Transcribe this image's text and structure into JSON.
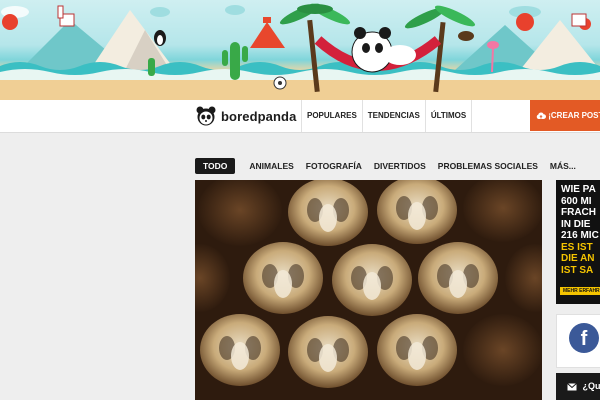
{
  "header": {
    "logo_text": "boredpanda",
    "logo_icon": "panda-icon",
    "nav": [
      "POPULARES",
      "TENDENCIAS",
      "ÚLTIMOS"
    ],
    "create_button": "¡CREAR POST",
    "create_icon": "cloud-upload-icon"
  },
  "categories": {
    "items": [
      "TODO",
      "ANIMALES",
      "FOTOGRAFÍA",
      "DIVERTIDOS",
      "PROBLEMAS SOCIALES",
      "MÁS..."
    ],
    "active": "TODO"
  },
  "main": {
    "hero_image": "bee-larvae-honeycomb-photo"
  },
  "sidebar": {
    "ad_lines": [
      "WIE PA",
      "600 MI",
      "FRACH",
      "IN DIE",
      "216 MIC",
      "ES IST",
      "DIE AN",
      "IST SA"
    ],
    "ad_more": "MEHR ERFAHR",
    "facebook_icon": "facebook-icon",
    "mail_label": "¿Qu"
  },
  "colors": {
    "accent": "#e35a25",
    "active_tab_bg": "#1a1a1a",
    "ad_highlight": "#f5c400",
    "facebook": "#3b5998"
  }
}
